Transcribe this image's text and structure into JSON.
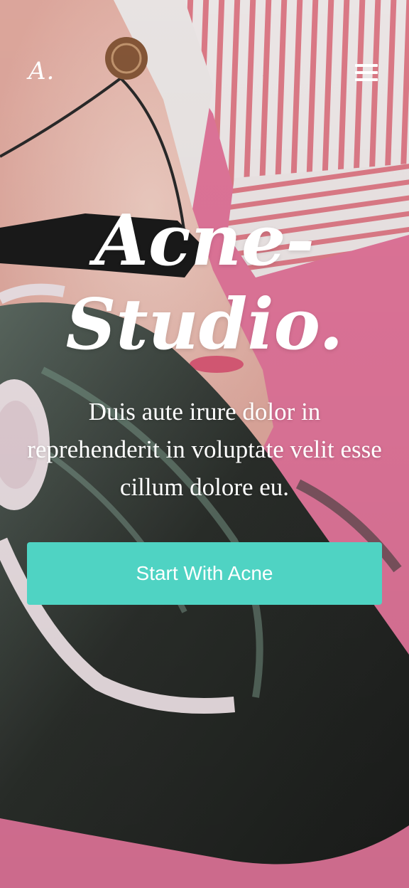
{
  "header": {
    "logo_text": "A.",
    "menu_icon": "hamburger-menu-icon"
  },
  "hero": {
    "title_line1": "Acne-",
    "title_line2": "Studio.",
    "subtitle": "Duis aute irure dolor in reprehenderit in voluptate velit esse cillum dolore eu.",
    "cta_label": "Start With Acne"
  },
  "colors": {
    "background_pink": "#e8799f",
    "cta": "#4fd3c3",
    "text": "#ffffff"
  }
}
